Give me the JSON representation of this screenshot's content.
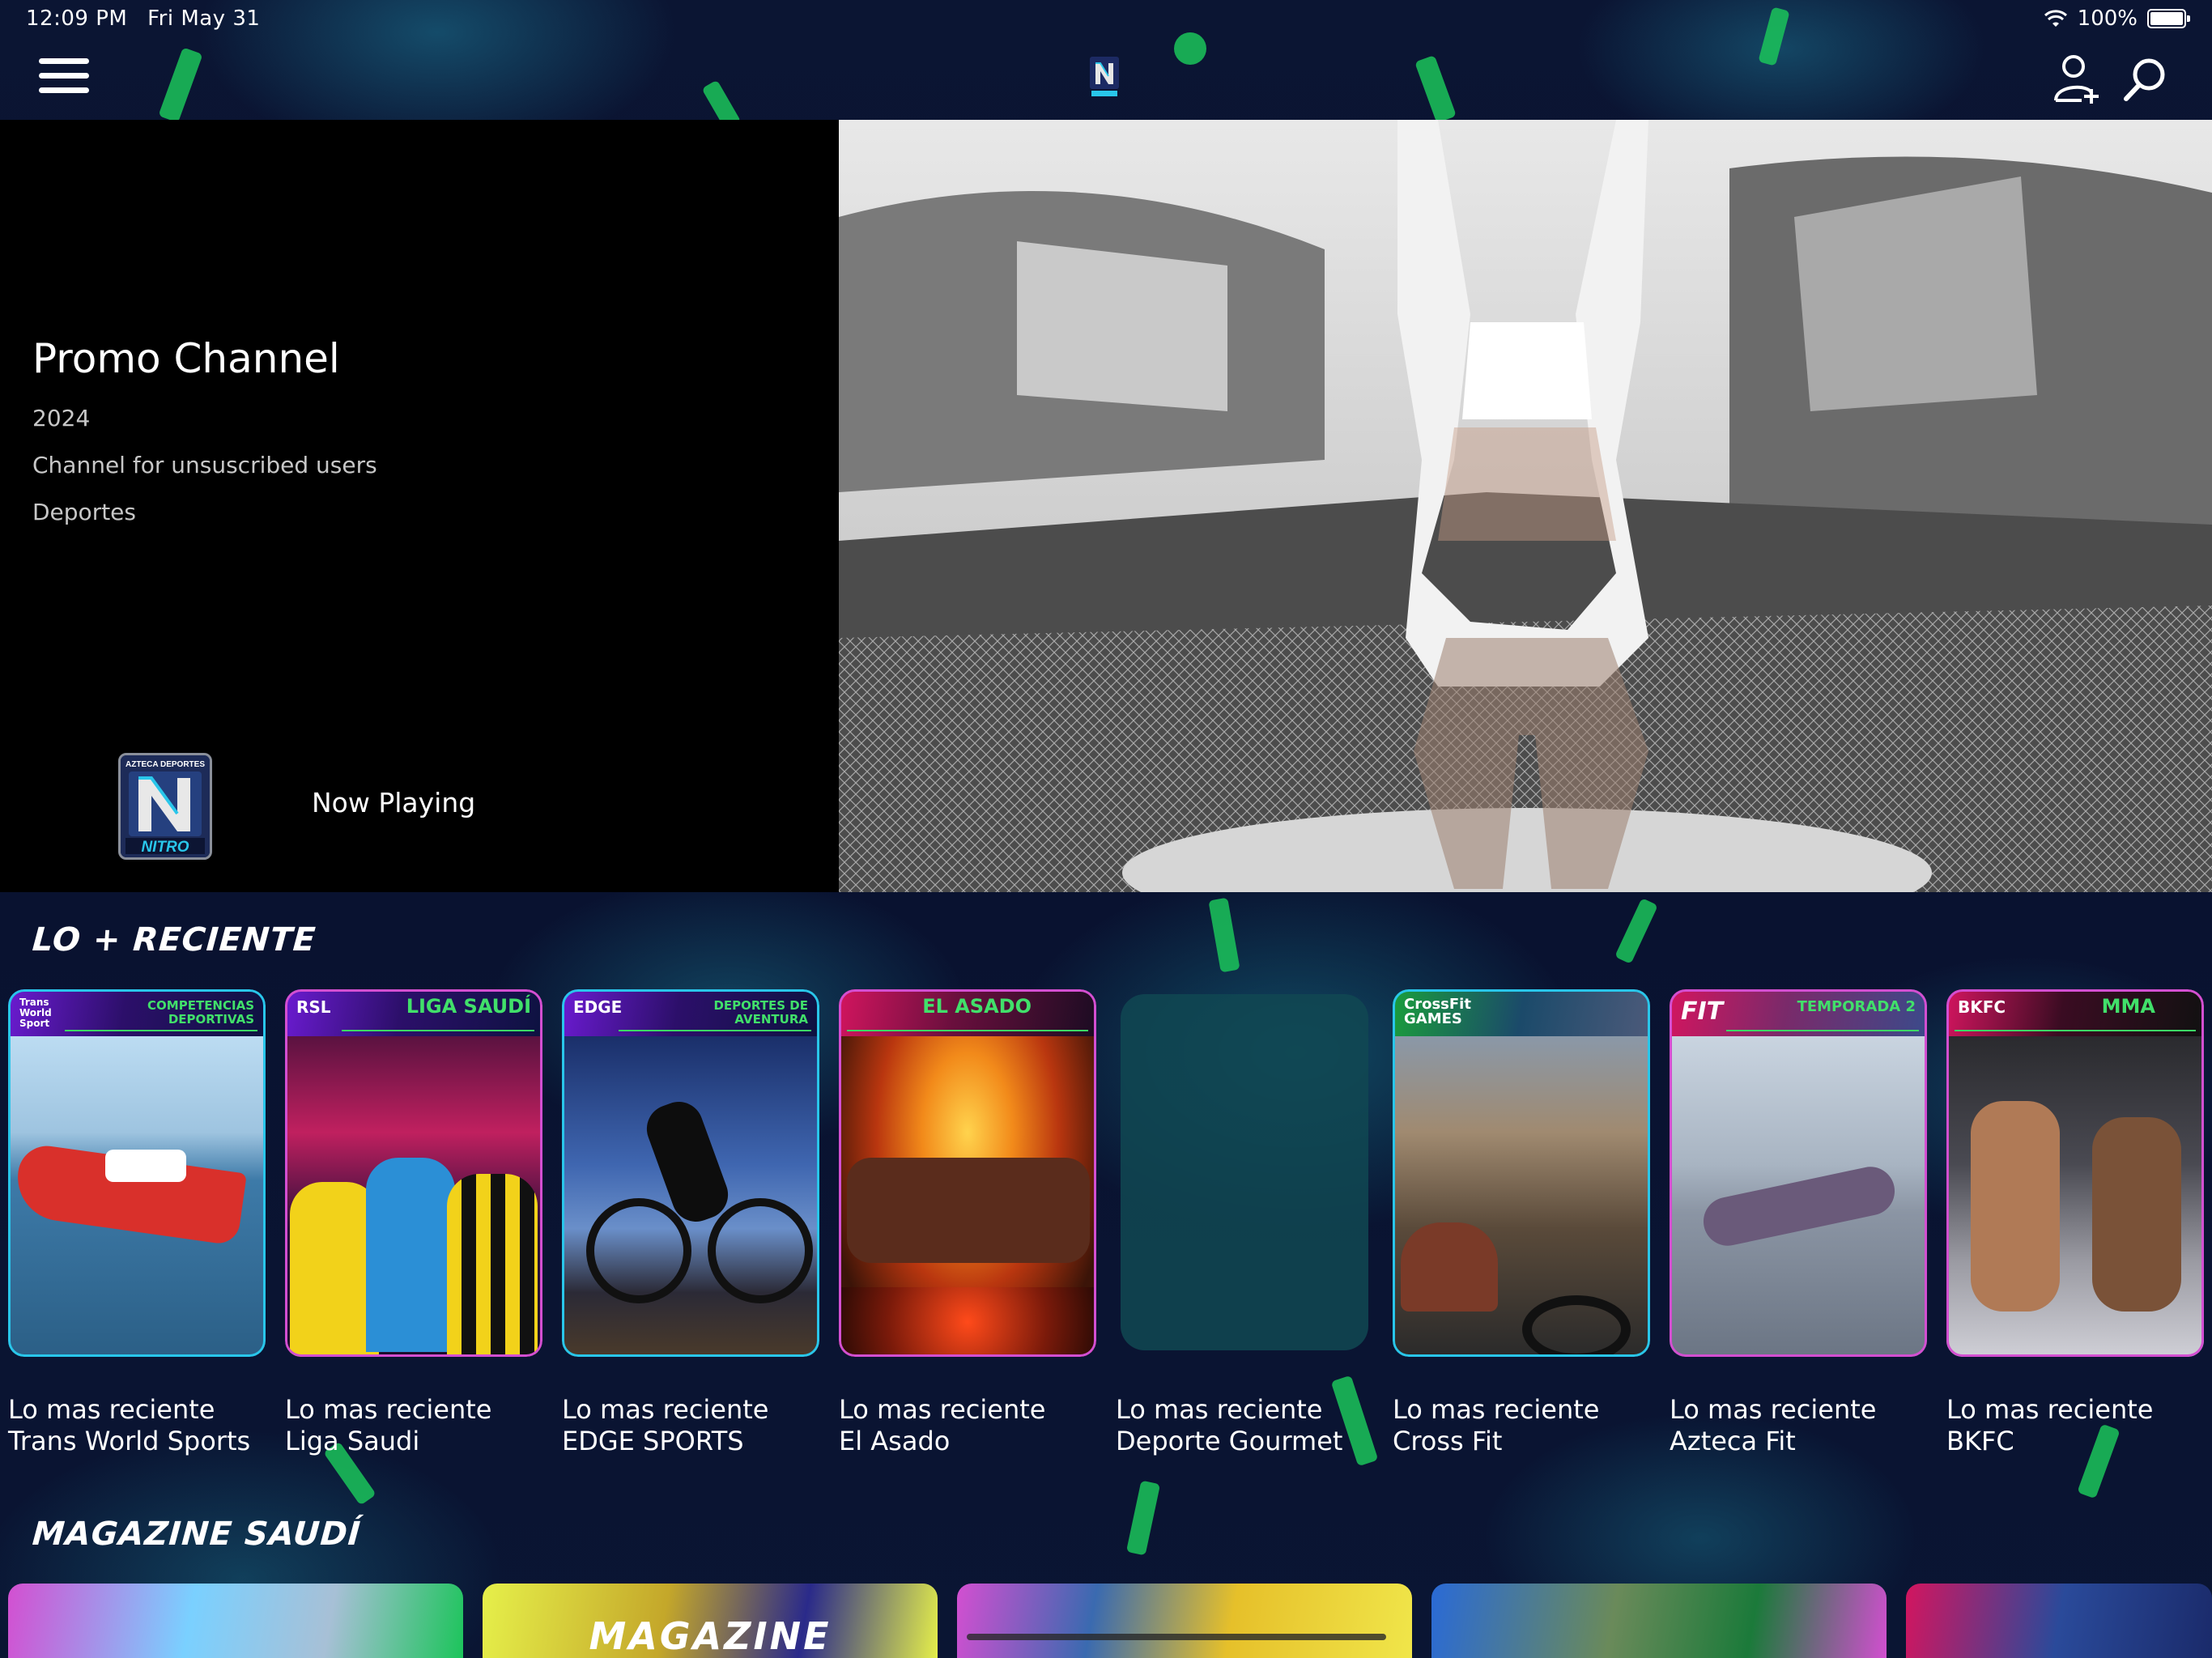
{
  "status_bar": {
    "time": "12:09 PM",
    "date": "Fri May 31",
    "battery": "100%"
  },
  "hero": {
    "title": "Promo Channel",
    "year": "2024",
    "description": "Channel for unsuscribed users",
    "genre": "Deportes",
    "now_playing": "Now Playing"
  },
  "sections": {
    "recent": {
      "title": "LO + RECIENTE",
      "cards": [
        {
          "tag_left": "Trans World Sport",
          "tag_right": "COMPETENCIAS DEPORTIVAS",
          "line1": "Lo mas reciente",
          "line2": "Trans World Sports"
        },
        {
          "tag_left": "RSL",
          "tag_right": "LIGA SAUDÍ",
          "line1": "Lo mas reciente",
          "line2": "Liga Saudi"
        },
        {
          "tag_left": "EDGE",
          "tag_right": "DEPORTES DE AVENTURA",
          "line1": "Lo mas reciente",
          "line2": "EDGE SPORTS"
        },
        {
          "tag_left": "",
          "tag_right": "EL ASADO",
          "line1": "Lo mas reciente",
          "line2": "El Asado"
        },
        {
          "tag_left": "",
          "tag_right": "",
          "line1": "Lo mas reciente",
          "line2": "Deporte Gourmet"
        },
        {
          "tag_left": "CrossFit GAMES",
          "tag_right": "",
          "line1": "Lo mas reciente",
          "line2": "Cross Fit"
        },
        {
          "tag_left": "FIT",
          "tag_right": "TEMPORADA 2",
          "line1": "Lo mas reciente",
          "line2": "Azteca Fit"
        },
        {
          "tag_left": "BKFC",
          "tag_right": "MMA",
          "line1": "Lo mas reciente",
          "line2": "BKFC"
        }
      ]
    },
    "magazine": {
      "title": "MAGAZINE SAUDÍ",
      "banner_text": "MAGAZINE"
    }
  },
  "brand": {
    "logo_top": "AZTECA DEPORTES",
    "logo_name": "NITRO",
    "accent": "#1bc45a",
    "frame": "#29c6ea"
  },
  "icons": [
    "menu-icon",
    "nitro-logo-icon",
    "add-user-icon",
    "search-icon",
    "wifi-icon",
    "battery-icon"
  ]
}
